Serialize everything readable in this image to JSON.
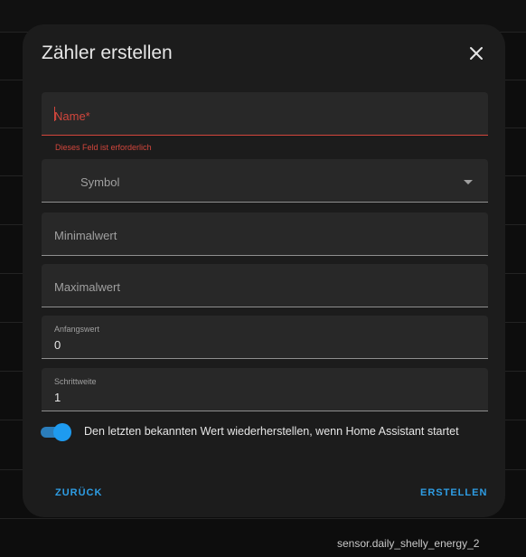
{
  "dialog": {
    "title": "Zähler erstellen",
    "close_icon": "close-icon"
  },
  "form": {
    "name": {
      "label": "Name*",
      "value": "",
      "error": "Dieses Feld ist erforderlich"
    },
    "icon": {
      "label": "Symbol",
      "icon": "chevron-down-icon"
    },
    "minimum": {
      "label": "Minimalwert",
      "value": ""
    },
    "maximum": {
      "label": "Maximalwert",
      "value": ""
    },
    "initial": {
      "label": "Anfangswert",
      "value": "0"
    },
    "step": {
      "label": "Schrittweite",
      "value": "1"
    },
    "restore": {
      "label": "Den letzten bekannten Wert wiederherstellen, wenn Home Assistant startet",
      "checked": true
    }
  },
  "actions": {
    "back_label": "ZURÜCK",
    "create_label": "ERSTELLEN"
  },
  "background": {
    "entity_id": "sensor.daily_shelly_energy_2"
  },
  "colors": {
    "accent": "#1e9bf0",
    "error": "#d2463c",
    "surface": "#1c1c1c",
    "field": "#282828"
  }
}
